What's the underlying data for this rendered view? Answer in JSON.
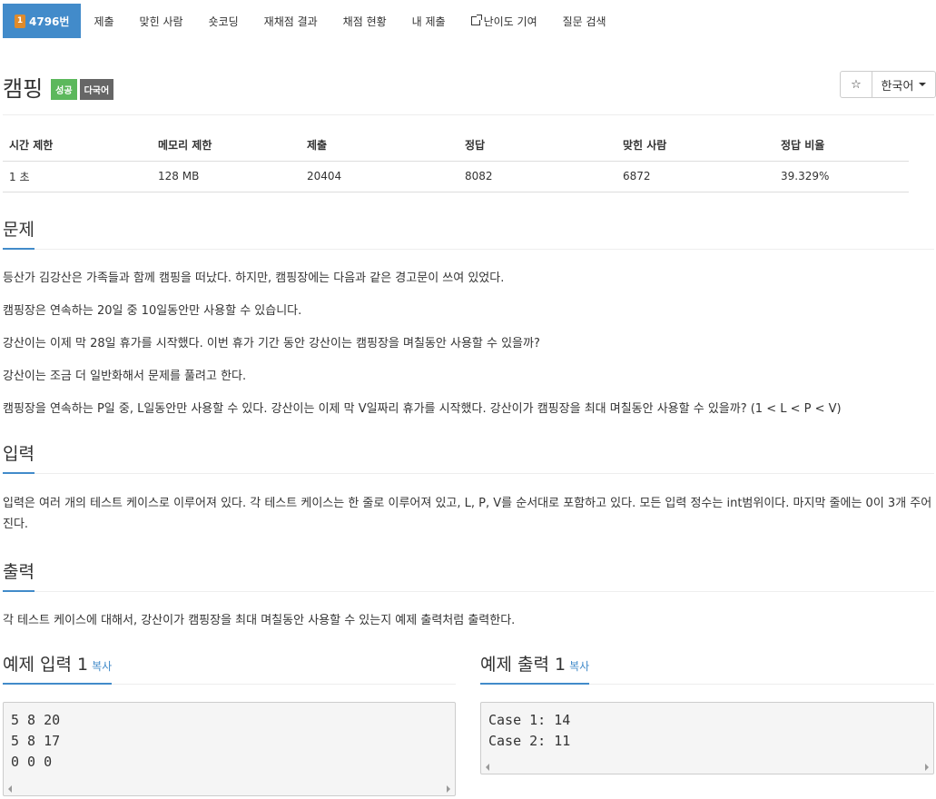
{
  "nav": {
    "problem_number": "4796번",
    "items": [
      "제출",
      "맞힌 사람",
      "숏코딩",
      "재채점 결과",
      "채점 현황",
      "내 제출",
      "난이도 기여",
      "질문 검색"
    ]
  },
  "title": "캠핑",
  "labels": {
    "success": "성공",
    "multilang": "다국어"
  },
  "language": {
    "selected": "한국어"
  },
  "star_glyph": "☆",
  "table": {
    "headers": [
      "시간 제한",
      "메모리 제한",
      "제출",
      "정답",
      "맞힌 사람",
      "정답 비율"
    ],
    "row": [
      "1 초",
      "128 MB",
      "20404",
      "8082",
      "6872",
      "39.329%"
    ]
  },
  "sections": {
    "problem": {
      "title": "문제",
      "paragraphs": [
        "등산가 김강산은 가족들과 함께 캠핑을 떠났다. 하지만, 캠핑장에는 다음과 같은 경고문이 쓰여 있었다.",
        "캠핑장은 연속하는 20일 중 10일동안만 사용할 수 있습니다.",
        "강산이는 이제 막 28일 휴가를 시작했다. 이번 휴가 기간 동안 강산이는 캠핑장을 며칠동안 사용할 수 있을까?",
        "강산이는 조금 더 일반화해서 문제를 풀려고 한다.",
        "캠핑장을 연속하는 P일 중, L일동안만 사용할 수 있다. 강산이는 이제 막 V일짜리 휴가를 시작했다. 강산이가 캠핑장을 최대 며칠동안 사용할 수 있을까? (1 < L < P < V)"
      ]
    },
    "input": {
      "title": "입력",
      "text": "입력은 여러 개의 테스트 케이스로 이루어져 있다. 각 테스트 케이스는 한 줄로 이루어져 있고, L, P, V를 순서대로 포함하고 있다. 모든 입력 정수는 int범위이다. 마지막 줄에는 0이 3개 주어진다."
    },
    "output": {
      "title": "출력",
      "text": "각 테스트 케이스에 대해서, 강산이가 캠핑장을 최대 며칠동안 사용할 수 있는지 예제 출력처럼 출력한다."
    }
  },
  "samples": {
    "input": {
      "title": "예제 입력 1",
      "copy": "복사",
      "lines": [
        "5 8 20",
        "5 8 17",
        "0 0 0"
      ]
    },
    "output": {
      "title": "예제 출력 1",
      "copy": "복사",
      "lines": [
        "Case 1: 14",
        "Case 2: 11"
      ]
    }
  },
  "colors": {
    "primary": "#428bca",
    "success": "#5cb85c",
    "default": "#666666",
    "badge": "#e08b2b"
  }
}
